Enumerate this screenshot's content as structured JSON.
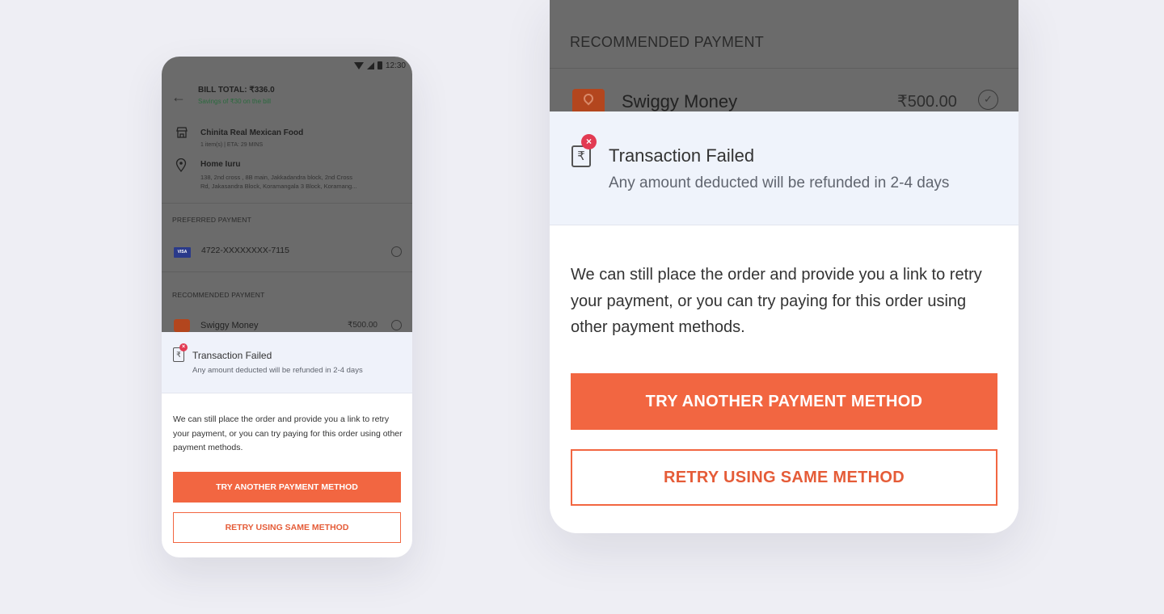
{
  "phone": {
    "status_time": "12:30",
    "bill_total": "BILL TOTAL: ₹336.0",
    "savings": "Savings of ₹30 on the bill",
    "restaurant_name": "Chinita Real Mexican Food",
    "restaurant_meta": "1 item(s) | ETA: 29 MINS",
    "address_label": "Home Iuru",
    "address_line1": "138, 2nd cross , 8B main, Jakkadandra block, 2nd Cross",
    "address_line2": "Rd, Jakasandra Block, Koramangala 3 Block, Koramang...",
    "preferred_label": "PREFERRED PAYMENT",
    "card_brand": "VISA",
    "card_number": "4722-XXXXXXXX-7115",
    "recommended_label": "RECOMMENDED PAYMENT",
    "wallet_name": "Swiggy Money",
    "wallet_amount": "₹500.00",
    "fail_title": "Transaction Failed",
    "fail_sub": "Any amount deducted will be refunded in 2-4 days",
    "body": "We can still place the order and provide you a link to retry your payment, or you can try paying  for this order using other payment methods.",
    "primary_button": "TRY ANOTHER PAYMENT METHOD",
    "secondary_button": "RETRY USING SAME METHOD"
  },
  "zoom": {
    "recommended_label": "RECOMMENDED PAYMENT",
    "wallet_name": "Swiggy Money",
    "wallet_amount": "₹500.00",
    "fail_title": "Transaction Failed",
    "fail_sub": "Any amount deducted will be refunded in 2-4 days",
    "body": "We can still place the order and provide you a link to retry your payment, or you can try paying  for this order using other payment methods.",
    "primary_button": "TRY ANOTHER PAYMENT METHOD",
    "secondary_button": "RETRY USING SAME METHOD"
  },
  "icons": {
    "rupee": "₹",
    "error": "×",
    "back": "←",
    "check": "✓"
  },
  "colors": {
    "accent": "#f26641",
    "error": "#e23a52",
    "savings_green": "#2b6a3e",
    "sheet_header": "#eff3fb"
  }
}
